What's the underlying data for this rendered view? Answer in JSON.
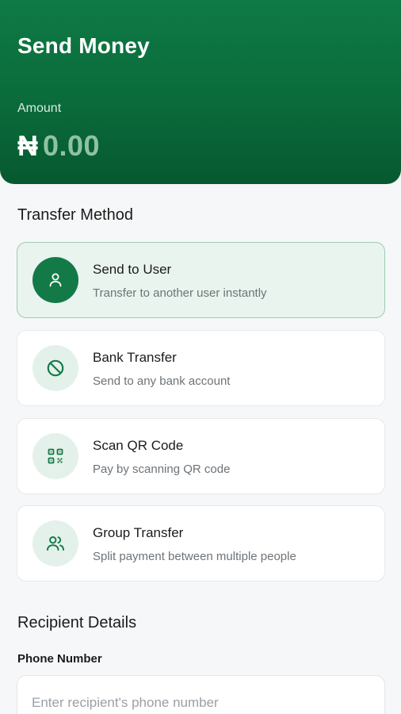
{
  "header": {
    "title": "Send Money",
    "amount_label": "Amount",
    "currency_symbol": "₦",
    "amount_value": "0.00"
  },
  "transfer_section": {
    "title": "Transfer Method",
    "methods": [
      {
        "title": "Send to User",
        "description": "Transfer to another user instantly",
        "icon": "user-icon",
        "selected": true
      },
      {
        "title": "Bank Transfer",
        "description": "Send to any bank account",
        "icon": "no-entry-icon",
        "selected": false
      },
      {
        "title": "Scan QR Code",
        "description": "Pay by scanning QR code",
        "icon": "qr-code-icon",
        "selected": false
      },
      {
        "title": "Group Transfer",
        "description": "Split payment between multiple people",
        "icon": "users-icon",
        "selected": false
      }
    ]
  },
  "recipient_section": {
    "title": "Recipient Details",
    "phone_label": "Phone Number",
    "phone_value": "",
    "phone_placeholder": "Enter recipient's phone number"
  },
  "colors": {
    "primary": "#0e7a45",
    "selected_bg": "#e9f4ee",
    "icon_bg": "#e4f1ea"
  }
}
